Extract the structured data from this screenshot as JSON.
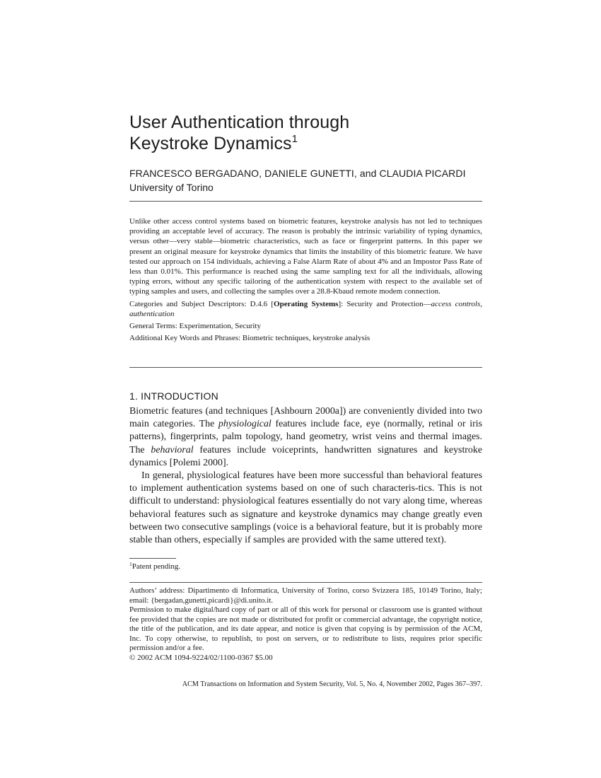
{
  "title": {
    "line1": "User Authentication through",
    "line2": "Keystroke Dynamics",
    "footnote_marker": "1"
  },
  "authors": "FRANCESCO BERGADANO, DANIELE GUNETTI, and CLAUDIA PICARDI",
  "affiliation": "University of Torino",
  "abstract": {
    "text": "Unlike other access control systems based on biometric features, keystroke analysis has not led to techniques providing an acceptable level of accuracy. The reason is probably the intrinsic variability of typing dynamics, versus other—very stable—biometric characteristics, such as face or fingerprint patterns. In this paper we present an original measure for keystroke dynamics that limits the instability of this biometric feature. We have tested our approach on 154 individuals, achieving a False Alarm Rate of about 4% and an Impostor Pass Rate of less than 0.01%. This performance is reached using the same sampling text for all the individuals, allowing typing errors, without any specific tailoring of the authentication system with respect to the available set of typing samples and users, and collecting the samples over a 28.8-Kbaud remote modem connection.",
    "categories_prefix": "Categories and Subject Descriptors: D.4.6 [",
    "categories_bold": "Operating Systems",
    "categories_mid": "]: Security and Protection—",
    "categories_italic": "access controls, authentication",
    "general_terms": "General Terms: Experimentation, Security",
    "keywords": "Additional Key Words and Phrases: Biometric techniques, keystroke analysis"
  },
  "section": {
    "heading": "1. INTRODUCTION",
    "p1_a": "Biometric features (and techniques [Ashbourn 2000a]) are conveniently divided into two main categories. The ",
    "p1_i1": "physiological",
    "p1_b": " features include face, eye (normally, retinal or iris patterns), fingerprints, palm topology, hand geometry, wrist veins and thermal images. The ",
    "p1_i2": "behavioral",
    "p1_c": " features include voiceprints, handwritten signatures and keystroke dynamics [Polemi 2000].",
    "p2": "In general, physiological features have been more successful than behavioral features to implement authentication systems based on one of such characteris-tics. This is not difficult to understand: physiological features essentially do not vary along time, whereas behavioral features such as signature and keystroke dynamics may change greatly even between two consecutive samplings (voice is a behavioral feature, but it is probably more stable than others, especially if samples are provided with the same uttered text)."
  },
  "footnote": {
    "marker": "1",
    "text": "Patent pending."
  },
  "fine_print": {
    "address": "Authors’ address: Dipartimento di Informatica, University of Torino, corso Svizzera 185, 10149 Torino, Italy; email: {bergadan,gunetti,picardi}@di.unito.it.",
    "permission": "Permission to make digital/hard copy of part or all of this work for personal or classroom use is granted without fee provided that the copies are not made or distributed for profit or commercial advantage, the copyright notice, the title of the publication, and its date appear, and notice is given that copying is by permission of the ACM, Inc. To copy otherwise, to republish, to post on servers, or to redistribute to lists, requires prior specific permission and/or a fee.",
    "copyright": "© 2002 ACM 1094-9224/02/1100-0367 $5.00"
  },
  "journal_line": "ACM Transactions on Information and System Security, Vol. 5, No. 4, November 2002, Pages 367–397."
}
